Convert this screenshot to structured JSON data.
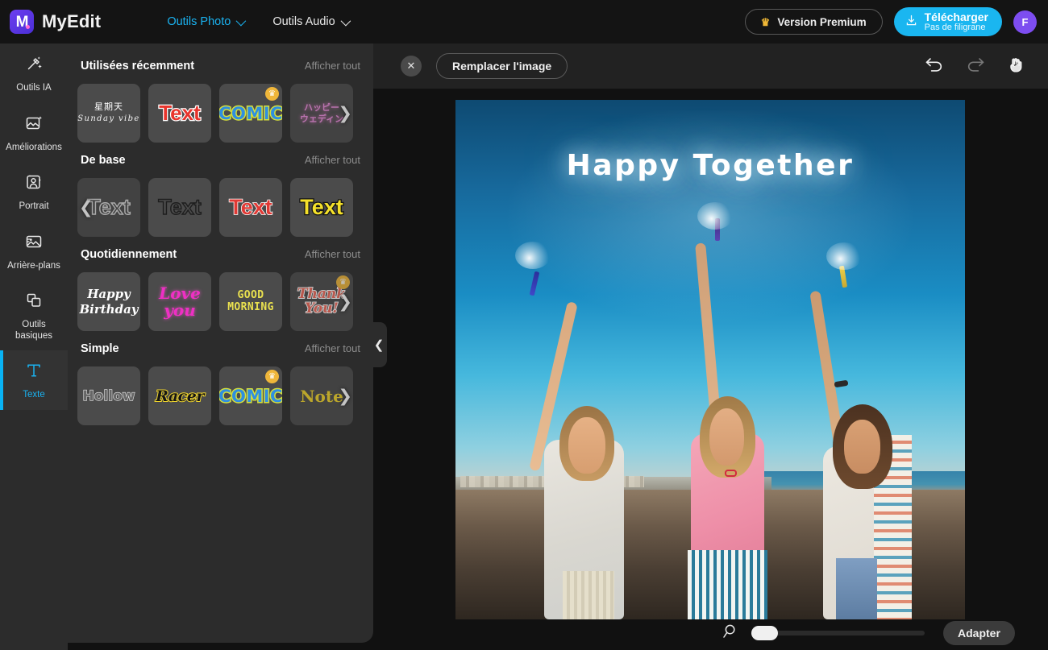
{
  "app": {
    "brand_name": "MyEdit",
    "logo_letter": "M"
  },
  "topbar": {
    "menu": [
      {
        "label": "Outils Photo",
        "icon": "chevron-down-icon",
        "active": true
      },
      {
        "label": "Outils Audio",
        "icon": "chevron-down-icon",
        "active": false
      }
    ],
    "premium_label": "Version Premium",
    "premium_icon": "crown-icon",
    "download": {
      "icon": "download-icon",
      "main_label": "Télécharger",
      "sub_label": "Pas de filigrane"
    },
    "avatar_initial": "F",
    "accent_color": "#1AB6F0",
    "avatar_color": "#7D4DF0",
    "crown_color": "#EFB736"
  },
  "rail": {
    "items": [
      {
        "label": "Outils IA",
        "icon": "magic-wand-icon",
        "active": false
      },
      {
        "label": "Améliorations",
        "icon": "image-sparkle-icon",
        "active": false
      },
      {
        "label": "Portrait",
        "icon": "portrait-icon",
        "active": false
      },
      {
        "label": "Arrière-plans",
        "icon": "background-image-icon",
        "active": false
      },
      {
        "label": "Outils basiques",
        "icon": "layers-icon",
        "active": false
      },
      {
        "label": "Texte",
        "icon": "text-T-icon",
        "active": true
      }
    ],
    "active_color": "#09B3F5"
  },
  "panel": {
    "show_all_label": "Afficher tout",
    "groups": [
      {
        "title": "Utilisées récemment",
        "show_all": "Afficher tout",
        "has_left_arrow": false,
        "has_right_arrow": true,
        "items": [
          {
            "art": "sunday",
            "line1": "星期天",
            "line2": "Sunday vibe",
            "premium": false
          },
          {
            "art": "red",
            "label": "Text",
            "premium": false
          },
          {
            "art": "comic",
            "label": "COMIC",
            "premium": true
          },
          {
            "art": "jp",
            "line1": "ハッピー",
            "line2": "ウェディン",
            "premium": false
          }
        ]
      },
      {
        "title": "De base",
        "show_all": "Afficher tout",
        "has_left_arrow": true,
        "has_right_arrow": false,
        "items": [
          {
            "art": "hollow-light",
            "label": "Text",
            "premium": false
          },
          {
            "art": "hollow-dark",
            "label": "Text",
            "premium": false
          },
          {
            "art": "red-thin",
            "label": "Text",
            "premium": false
          },
          {
            "art": "yellow",
            "label": "Text",
            "premium": false
          }
        ]
      },
      {
        "title": "Quotidiennement",
        "show_all": "Afficher tout",
        "has_left_arrow": false,
        "has_right_arrow": true,
        "items": [
          {
            "art": "script-white",
            "line1": "Happy",
            "line2": "Birthday",
            "premium": false
          },
          {
            "art": "script-pink",
            "line1": "Love",
            "line2": "you",
            "premium": false
          },
          {
            "art": "good-morning",
            "line1": "GOOD",
            "line2": "MORNING",
            "premium": false
          },
          {
            "art": "thank-you",
            "line1": "Thank",
            "line2": "You!",
            "premium": true
          }
        ]
      },
      {
        "title": "Simple",
        "show_all": "Afficher tout",
        "has_left_arrow": false,
        "has_right_arrow": true,
        "items": [
          {
            "art": "hollow2",
            "label": "Hollow",
            "premium": false
          },
          {
            "art": "racer",
            "label": "Racer",
            "premium": false
          },
          {
            "art": "comic",
            "label": "COMIC",
            "premium": true
          },
          {
            "art": "note",
            "label": "Note",
            "premium": false
          }
        ]
      }
    ],
    "collapse_icon": "chevron-left-icon"
  },
  "editor_bar": {
    "close_icon": "close-icon",
    "replace_label": "Remplacer l'image",
    "undo_icon": "undo-icon",
    "redo_icon": "redo-icon",
    "hand_icon": "hand-tool-icon",
    "undo_enabled": true,
    "redo_enabled": false
  },
  "canvas": {
    "overlay_text": "Happy Together",
    "image_alt": "Trois femmes avec des cierges magiques sur la plage au coucher du soleil"
  },
  "zoom_bar": {
    "magnifier_icon": "search-icon",
    "slider_value": 0,
    "fit_label": "Adapter"
  }
}
